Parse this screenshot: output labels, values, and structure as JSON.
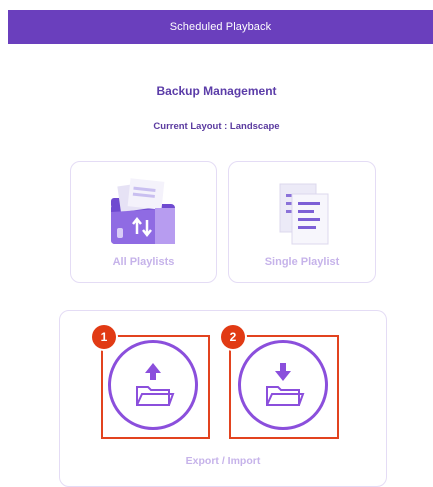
{
  "header": {
    "title": "Scheduled Playback"
  },
  "page": {
    "heading": "Backup Management",
    "layout_text": "Current Layout : Landscape"
  },
  "options": [
    {
      "label": "All Playlists",
      "icon": "folder-transfer-icon"
    },
    {
      "label": "Single Playlist",
      "icon": "documents-icon"
    }
  ],
  "export_import": {
    "label": "Export / Import",
    "buttons": [
      {
        "badge": "1",
        "icon": "folder-upload-icon"
      },
      {
        "badge": "2",
        "icon": "folder-download-icon"
      }
    ]
  },
  "colors": {
    "header_bg": "#6a3fbd",
    "accent": "#8b4fdc",
    "highlight": "#e2431f",
    "muted_label": "#c6b3ea"
  }
}
